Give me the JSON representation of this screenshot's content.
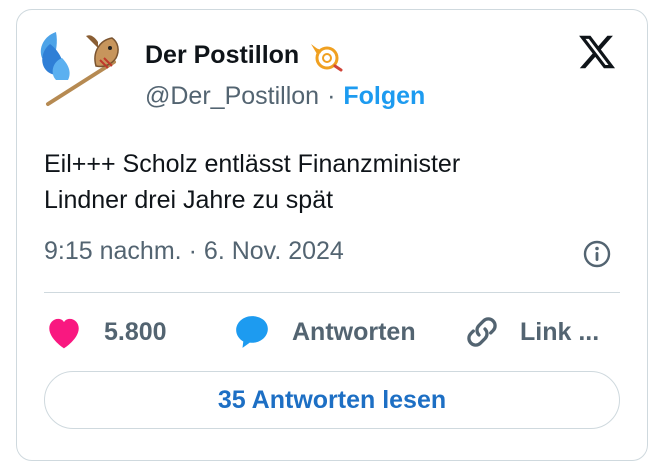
{
  "tweet": {
    "author": {
      "name": "Der Postillon",
      "handle": "@Der_Postillon",
      "separator": "·",
      "follow_label": "Folgen",
      "avatar_icon": "winged-hobby-horse-icon",
      "badge_icon": "post-horn-icon"
    },
    "text_lines": [
      "Eil+++ Scholz entlässt Finanzminister",
      "Lindner drei Jahre zu spät"
    ],
    "meta": {
      "time": "9:15 nachm.",
      "separator": "·",
      "date": "6. Nov. 2024"
    },
    "actions": {
      "like_count": "5.800",
      "reply_label": "Antworten",
      "link_label": "Link ..."
    },
    "read_replies_label": "35 Antworten lesen"
  },
  "colors": {
    "accent": "#1d9bf0",
    "button_text": "#1d6fc4",
    "like": "#f91880",
    "muted": "#536471",
    "border": "#cfd9de",
    "horn": "#f0a020"
  }
}
